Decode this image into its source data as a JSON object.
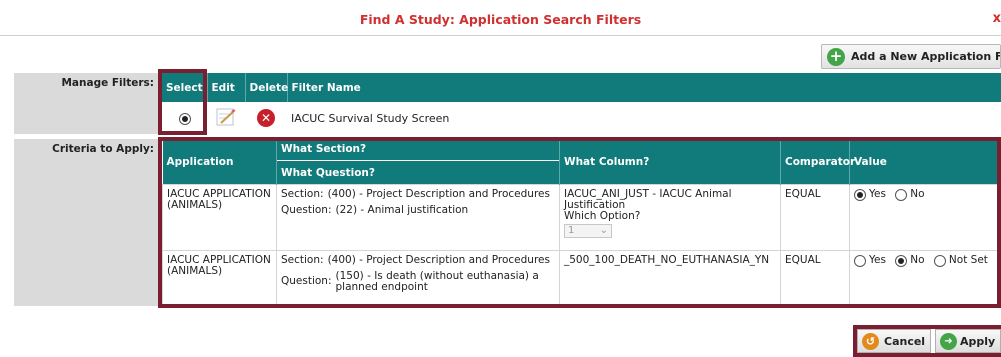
{
  "title": "Find A Study: Application Search Filters",
  "close_glyph": "x",
  "add_filter_label": "Add a New Application Filter",
  "manage_filters_label": "Manage Filters:",
  "criteria_label": "Criteria to Apply:",
  "filters_table": {
    "headers": [
      "Select",
      "Edit",
      "Delete",
      "Filter Name"
    ],
    "rows": [
      {
        "selected": true,
        "name": "IACUC Survival Study Screen"
      }
    ]
  },
  "criteria_table": {
    "headers": {
      "application": "Application",
      "what_section": "What Section?",
      "what_question": "What Question?",
      "what_column": "What Column?",
      "comparator": "Comparator",
      "value": "Value"
    },
    "section_label": "Section:",
    "question_label": "Question:",
    "rows": [
      {
        "application": "IACUC APPLICATION (ANIMALS)",
        "section": "(400) - Project Description and Procedures",
        "question": "(22) - Animal justification",
        "column": "IACUC_ANI_JUST - IACUC Animal Justification",
        "which_option_label": "Which Option?",
        "which_option_value": "1",
        "comparator": "EQUAL",
        "options": [
          {
            "label": "Yes",
            "selected": true
          },
          {
            "label": "No",
            "selected": false
          }
        ]
      },
      {
        "application": "IACUC APPLICATION (ANIMALS)",
        "section": "(400) - Project Description and Procedures",
        "question": "(150) - Is death (without euthanasia) a planned endpoint",
        "column": "_500_100_DEATH_NO_EUTHANASIA_YN",
        "comparator": "EQUAL",
        "options": [
          {
            "label": "Yes",
            "selected": false
          },
          {
            "label": "No",
            "selected": true
          },
          {
            "label": "Not Set",
            "selected": false
          }
        ]
      }
    ]
  },
  "cancel_label": "Cancel",
  "apply_label": "Apply",
  "colors": {
    "title_red": "#d03030",
    "header_teal": "#117a7a",
    "highlight_maroon": "#7a1e32"
  }
}
